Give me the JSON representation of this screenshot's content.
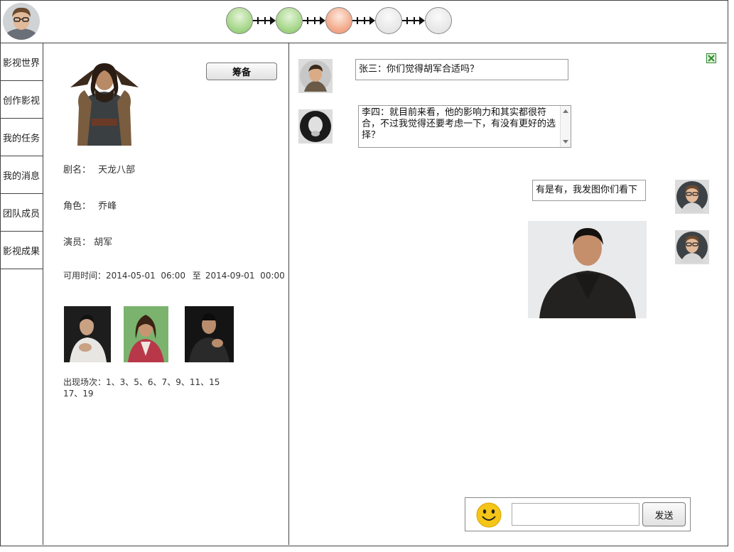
{
  "nav": {
    "items": [
      "影视世界",
      "创作影视",
      "我的任务",
      "我的消息",
      "团队成员",
      "影视成果"
    ]
  },
  "progress": {
    "steps": [
      "done",
      "done",
      "current",
      "todo",
      "todo"
    ]
  },
  "detail": {
    "prepare_button": "筹备",
    "drama": {
      "label": "剧名：",
      "value": "天龙八部"
    },
    "role": {
      "label": "角色：",
      "value": "乔峰"
    },
    "actor": {
      "label": "演员：",
      "value": "胡军"
    },
    "available": {
      "label": "可用时间：",
      "start": "2014-05-01  06:00",
      "sep": "至",
      "end": "2014-09-01  00:00"
    },
    "scenes": {
      "label": "出现场次：",
      "line1": "1、3、5、6、7、9、11、15",
      "line2": "17、19"
    }
  },
  "chat": {
    "messages": [
      {
        "sender": "张三",
        "text": "张三：你们觉得胡军合适吗？"
      },
      {
        "sender": "李四",
        "text": "李四：就目前来看，他的影响力和其实都很符合，不过我觉得还要考虑一下，有没有更好的选择？"
      },
      {
        "sender": "me",
        "text": "有是有，我发图你们看下"
      }
    ],
    "send_button": "发送",
    "input_value": ""
  },
  "colors": {
    "done": "#a8d88c",
    "current": "#f3ad8f",
    "todo": "#e6e6e6",
    "close_green": "#2e8b2e"
  }
}
